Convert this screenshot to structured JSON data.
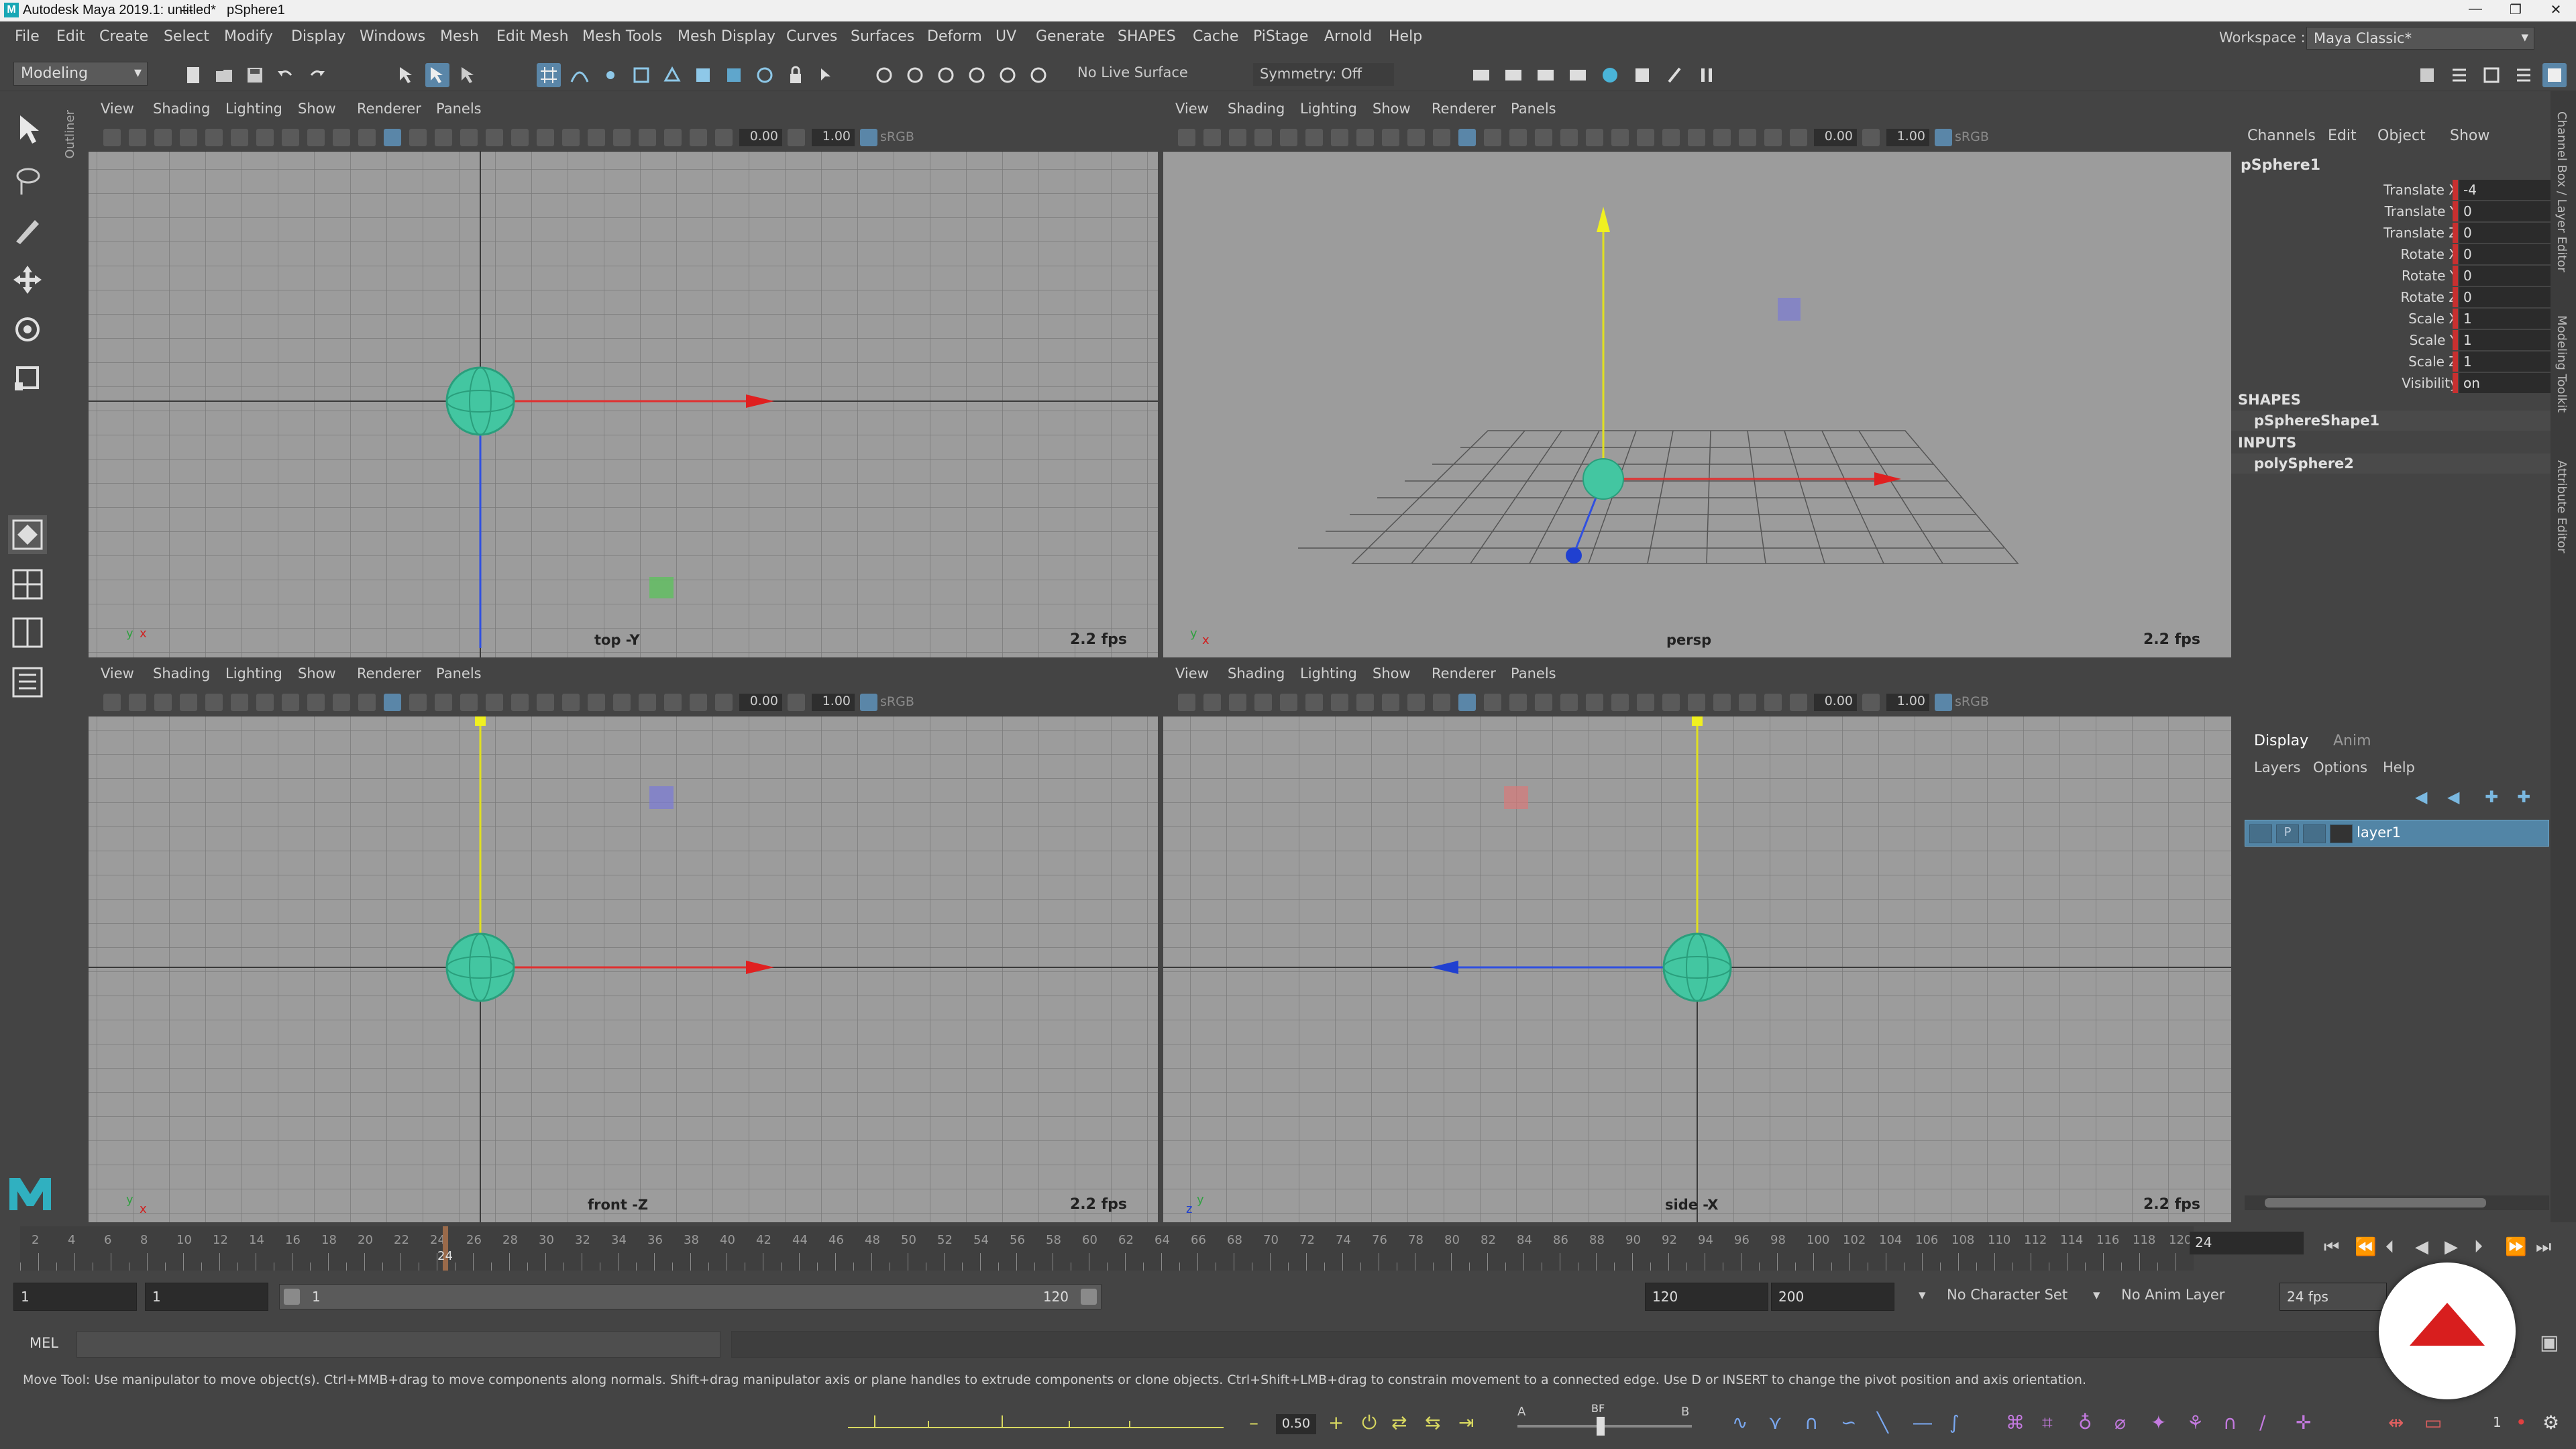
{
  "window": {
    "title": "Autodesk Maya 2019.1: untitled*",
    "separator": "---",
    "object": "pSphere1",
    "controls": [
      "—",
      "❐",
      "✕"
    ]
  },
  "menus": [
    "File",
    "Edit",
    "Create",
    "Select",
    "Modify",
    "Display",
    "Windows",
    "Mesh",
    "Edit Mesh",
    "Mesh Tools",
    "Mesh Display",
    "Curves",
    "Surfaces",
    "Deform",
    "UV",
    "Generate",
    "SHAPES",
    "Cache",
    "PiStage",
    "Arnold",
    "Help"
  ],
  "workspace": {
    "label": "Workspace :",
    "value": "Maya Classic*"
  },
  "statusline": {
    "mode": "Modeling",
    "live_surface": "No Live Surface",
    "symmetry": "Symmetry: Off"
  },
  "outliner_tab": "Outliner",
  "viewport_menu": [
    "View",
    "Shading",
    "Lighting",
    "Show",
    "Renderer",
    "Panels"
  ],
  "viewport_toolbar": {
    "value_a": "0.00",
    "value_b": "1.00",
    "colorspace": "sRGB"
  },
  "viewports": [
    {
      "name": "top -Y",
      "fps": "2.2 fps"
    },
    {
      "name": "persp",
      "fps": "2.2 fps"
    },
    {
      "name": "front -Z",
      "fps": "2.2 fps"
    },
    {
      "name": "side -X",
      "fps": "2.2 fps"
    }
  ],
  "channelbox": {
    "tabs": [
      "Channels",
      "Edit",
      "Object",
      "Show"
    ],
    "object": "pSphere1",
    "attributes": [
      {
        "label": "Translate X",
        "value": "-4"
      },
      {
        "label": "Translate Y",
        "value": "0"
      },
      {
        "label": "Translate Z",
        "value": "0"
      },
      {
        "label": "Rotate X",
        "value": "0"
      },
      {
        "label": "Rotate Y",
        "value": "0"
      },
      {
        "label": "Rotate Z",
        "value": "0"
      },
      {
        "label": "Scale X",
        "value": "1"
      },
      {
        "label": "Scale Y",
        "value": "1"
      },
      {
        "label": "Scale Z",
        "value": "1"
      },
      {
        "label": "Visibility",
        "value": "on"
      }
    ],
    "shapes_header": "SHAPES",
    "shape_node": "pSphereShape1",
    "inputs_header": "INPUTS",
    "input_node": "polySphere2"
  },
  "side_tabs": [
    "Channel Box / Layer Editor",
    "Modeling Toolkit",
    "Attribute Editor"
  ],
  "layer_editor": {
    "tabs": [
      "Display",
      "Anim"
    ],
    "menu": [
      "Layers",
      "Options",
      "Help"
    ],
    "layer": {
      "v": "",
      "p": "P",
      "name": "layer1"
    }
  },
  "timeline": {
    "ticks": [
      "2",
      "4",
      "6",
      "8",
      "10",
      "12",
      "14",
      "16",
      "18",
      "20",
      "22",
      "24",
      "26",
      "28",
      "30",
      "32",
      "34",
      "36",
      "38",
      "40",
      "42",
      "44",
      "46",
      "48",
      "50",
      "52",
      "54",
      "56",
      "58",
      "60",
      "62",
      "64",
      "66",
      "68",
      "70",
      "72",
      "74",
      "76",
      "78",
      "80",
      "82",
      "84",
      "86",
      "88",
      "90",
      "92",
      "94",
      "96",
      "98",
      "100",
      "102",
      "104",
      "106",
      "108",
      "110",
      "112",
      "114",
      "116",
      "118",
      "120"
    ],
    "current_label": "24",
    "current_frame": "24"
  },
  "range": {
    "start": "1",
    "playback_start": "1",
    "range_start": "1",
    "range_end": "120",
    "playback_end": "120",
    "end": "200",
    "character_set": "No Character Set",
    "anim_layer": "No Anim Layer",
    "fps": "24 fps"
  },
  "commandline": {
    "mel_label": "MEL"
  },
  "helpline": "Move Tool: Use manipulator to move object(s). Ctrl+MMB+drag to move components along normals. Shift+drag manipulator axis or plane handles to extrude components or clone objects. Ctrl+Shift+LMB+drag to constrain movement to a connected edge. Use D or INSERT to change the pivot position and axis orientation.",
  "shelf": {
    "value": "0.50",
    "counter": "1",
    "slider_left": "A",
    "slider_mid": "BF",
    "slider_right": "B"
  },
  "colors": {
    "accent": "#5ac8e6",
    "selected_layer": "#5285a6",
    "keyed": "#c83030",
    "sphere": "#3fc9a0"
  }
}
